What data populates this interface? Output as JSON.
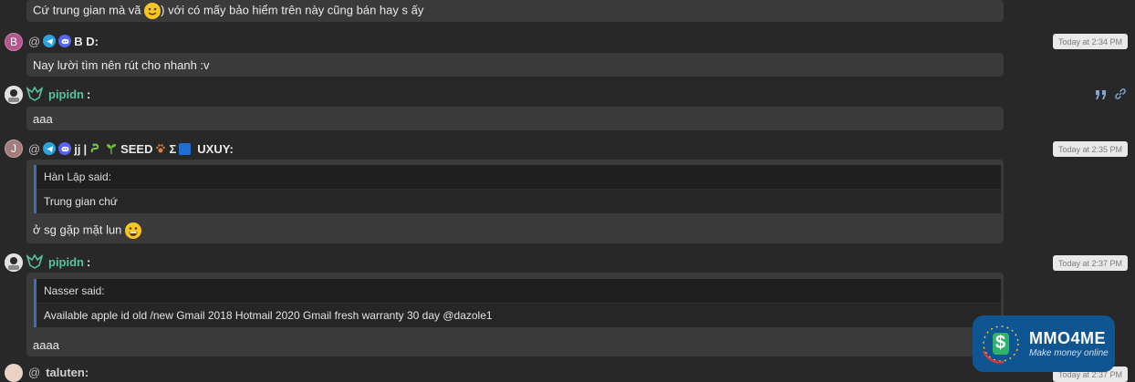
{
  "messages": [
    {
      "body_pre": "Cứ trung gian mà vã ",
      "body_post": ") với có mấy bảo hiểm trên này cũng bán hay s ấy"
    },
    {
      "avatar_letter": "B",
      "username": "B D:",
      "timestamp": "Today at 2:34 PM",
      "body": "Nay lười tìm nên rút cho nhanh :v"
    },
    {
      "username": "pipidn",
      "colon": ":",
      "body": "aaa"
    },
    {
      "avatar_letter": "J",
      "username_parts": [
        "jj",
        "|",
        "SEED",
        "Σ",
        "UXUY:"
      ],
      "timestamp": "Today at 2:35 PM",
      "quote_author": "Hàn Lập said:",
      "quote_text": "Trung gian chứ",
      "body": "ở sg gặp mặt lun "
    },
    {
      "username": "pipidn",
      "colon": ":",
      "timestamp": "Today at 2:37 PM",
      "quote_author": "Nasser said:",
      "quote_text": "Available apple id old /new Gmail 2018 Hotmail 2020 Gmail fresh warranty 30 day @dazole1",
      "body": "aaaa"
    },
    {
      "username": "taluten:",
      "timestamp": "Today at 2:37 PM"
    }
  ],
  "prefix": "@",
  "watermark": {
    "name": "MMO4ME",
    "tagline": "Make money online",
    "symbol": "$"
  },
  "colors": {
    "accent_green": "#57c1a1",
    "quote_border": "#3f6bbd",
    "telegram": "#2aa3df",
    "discord": "#5865f2"
  }
}
